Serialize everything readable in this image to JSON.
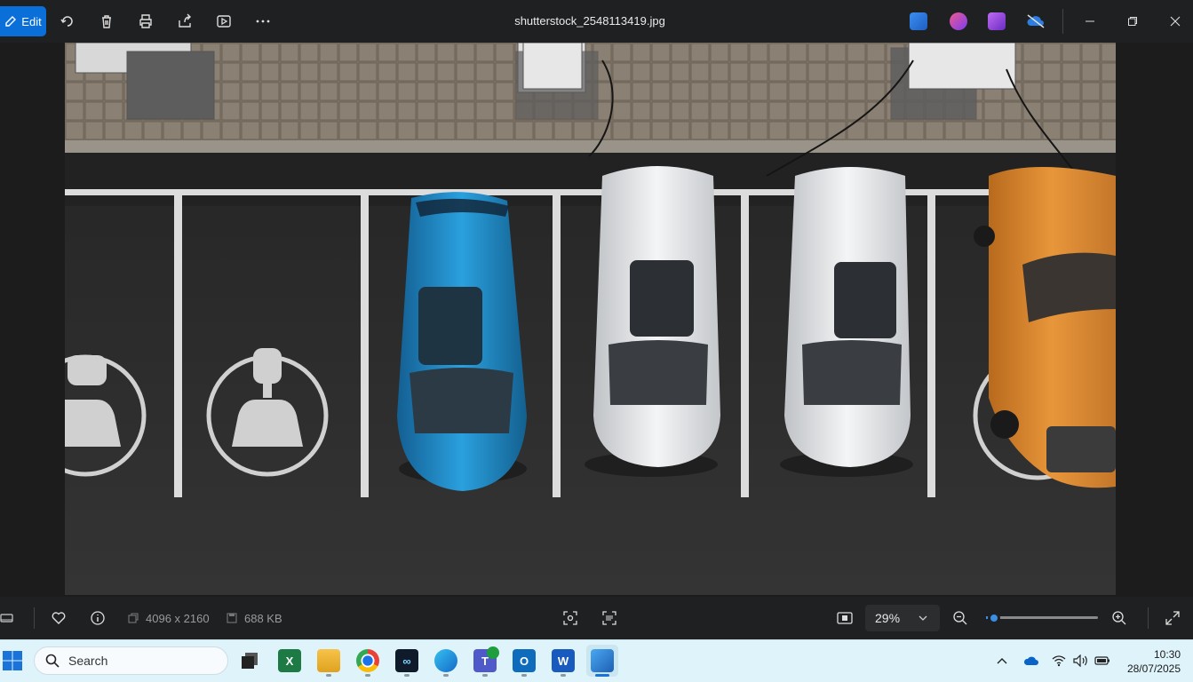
{
  "toolbar": {
    "edit_label": "Edit",
    "filename": "shutterstock_2548113419.jpg"
  },
  "info": {
    "dimensions": "4096 x 2160",
    "file_size": "688 KB"
  },
  "zoom": {
    "value": "29%",
    "slider_fraction": 0.04
  },
  "taskbar": {
    "search_placeholder": "Search",
    "time": "10:30",
    "date": "28/07/2025"
  },
  "colors": {
    "accent": "#0a6fd8",
    "asphalt": "#2e2e2e",
    "car_blue": "#1f88c4",
    "car_white": "#e9eaec",
    "car_orange": "#d9862e"
  }
}
